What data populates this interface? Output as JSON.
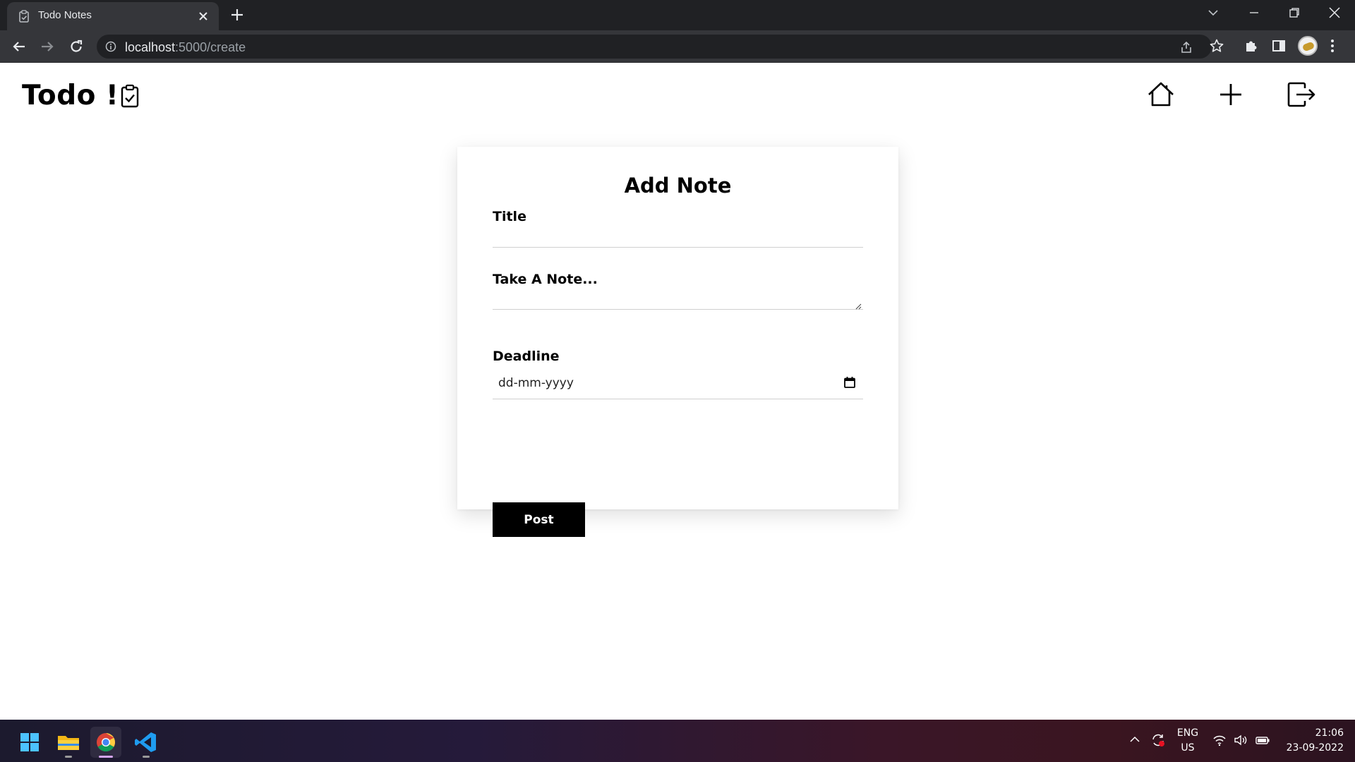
{
  "browser": {
    "tab_title": "Todo Notes",
    "url_host": "localhost",
    "url_path": ":5000/create"
  },
  "app": {
    "brand": "Todo !",
    "nav": [
      "home-icon",
      "plus-icon",
      "logout-icon"
    ]
  },
  "form": {
    "heading": "Add Note",
    "title_label": "Title",
    "title_value": "",
    "note_label": "Take A Note...",
    "note_value": "",
    "deadline_label": "Deadline",
    "deadline_placeholder": "dd-mm-yyyy",
    "post_label": "Post"
  },
  "taskbar": {
    "lang_top": "ENG",
    "lang_bottom": "US",
    "time": "21:06",
    "date": "23-09-2022"
  },
  "colors": {
    "chrome_dark": "#202124",
    "chrome_mid": "#35363a",
    "button_black": "#000000"
  }
}
